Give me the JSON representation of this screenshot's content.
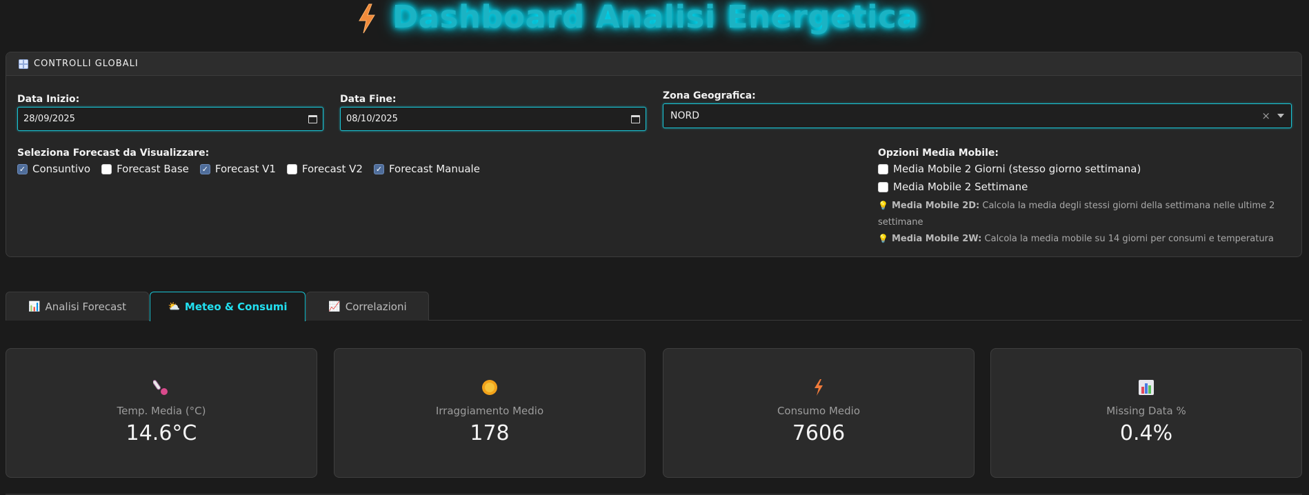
{
  "header": {
    "title": "Dashboard Analisi Energetica",
    "icon": "lightning-bolt-icon"
  },
  "controls": {
    "section_title": "CONTROLLI GLOBALI",
    "start_date": {
      "label": "Data Inizio:",
      "value": "28/09/2025"
    },
    "end_date": {
      "label": "Data Fine:",
      "value": "08/10/2025"
    },
    "zone": {
      "label": "Zona Geografica:",
      "value": "NORD",
      "clear": "×"
    },
    "forecast": {
      "label": "Seleziona Forecast da Visualizzare:",
      "options": [
        {
          "label": "Consuntivo",
          "checked": true
        },
        {
          "label": "Forecast Base",
          "checked": false
        },
        {
          "label": "Forecast V1",
          "checked": true
        },
        {
          "label": "Forecast V2",
          "checked": false
        },
        {
          "label": "Forecast Manuale",
          "checked": true
        }
      ]
    },
    "moving_average": {
      "label": "Opzioni Media Mobile:",
      "options": [
        {
          "label": "Media Mobile 2 Giorni (stesso giorno settimana)",
          "checked": false
        },
        {
          "label": "Media Mobile 2 Settimane",
          "checked": false
        }
      ],
      "hint_2d_title": "Media Mobile 2D:",
      "hint_2d_text": "Calcola la media degli stessi giorni della settimana nelle ultime 2",
      "hint_2d_text_2": "settimane",
      "hint_2w_title": "Media Mobile 2W:",
      "hint_2w_text": "Calcola la media mobile su 14 giorni per consumi e temperatura"
    }
  },
  "tabs": [
    {
      "label": "Analisi Forecast",
      "icon": "bar-chart-icon",
      "active": false
    },
    {
      "label": "Meteo & Consumi",
      "icon": "sun-cloud-icon",
      "active": true
    },
    {
      "label": "Correlazioni",
      "icon": "line-chart-icon",
      "active": false
    }
  ],
  "kpis": [
    {
      "label": "Temp. Media (°C)",
      "value": "14.6°C",
      "icon": "thermometer-icon"
    },
    {
      "label": "Irraggiamento Medio",
      "value": "178",
      "icon": "sun-icon"
    },
    {
      "label": "Consumo Medio",
      "value": "7606",
      "icon": "lightning-bolt-icon"
    },
    {
      "label": "Missing Data %",
      "value": "0.4%",
      "icon": "bar-chart-icon"
    }
  ],
  "colors": {
    "accent": "#19c6d6",
    "title_glow": "#00e5ff",
    "background": "#1b1b1b",
    "card": "#2b2b2b"
  }
}
